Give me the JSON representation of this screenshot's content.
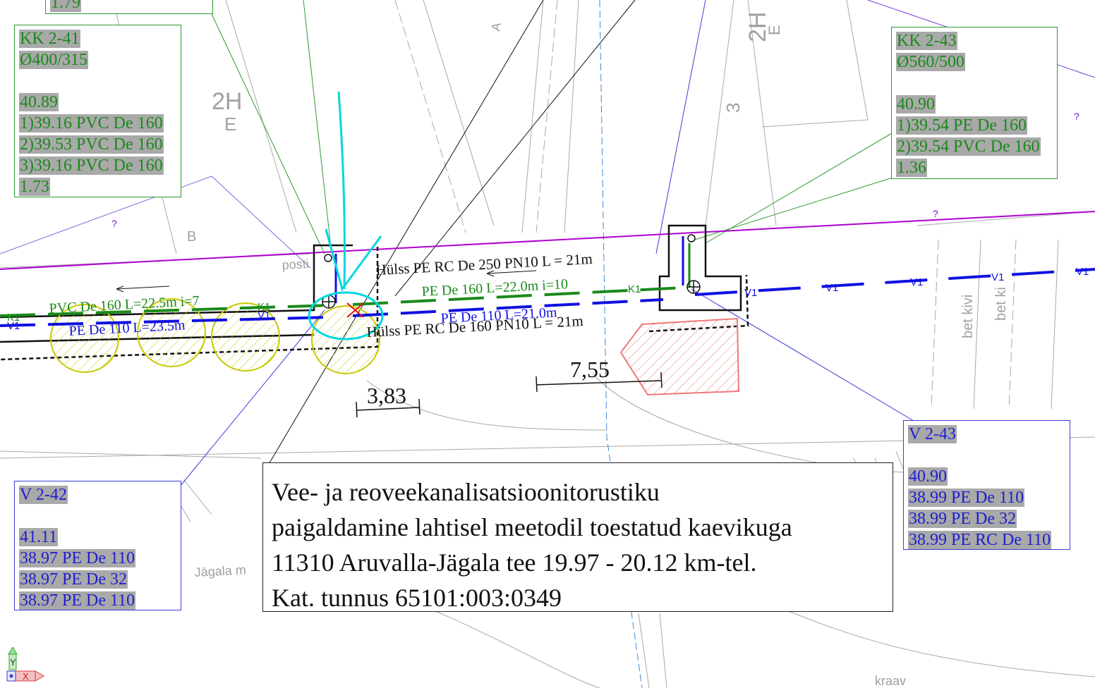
{
  "boxes": {
    "kk241": {
      "lines": [
        "KK 2-41",
        "Ø400/315",
        "",
        "40.89",
        "1)39.16 PVC De 160",
        "2)39.53 PVC De 160",
        "3)39.16 PVC De 160",
        "1.73"
      ]
    },
    "kk243": {
      "lines": [
        "KK 2-43",
        "Ø560/500",
        "",
        "40.90",
        "1)39.54 PE De 160",
        "2)39.54 PVC De 160",
        "1.36"
      ]
    },
    "v242": {
      "lines": [
        "V 2-42",
        "",
        "41.11",
        "38.97 PE De 110",
        "38.97 PE De 32",
        "38.97 PE De 110"
      ]
    },
    "v243": {
      "lines": [
        "V 2-43",
        "",
        "40.90",
        "38.99 PE De 110",
        "38.99 PE De 32",
        "38.99 PE RC De 110"
      ]
    },
    "top_partial": {
      "value": "1.79"
    }
  },
  "title_block": {
    "lines": [
      "Vee- ja reoveekanalisatsioonitorustiku",
      "paigaldamine lahtisel meetodil toestatud kaevikuga",
      "11310 Aruvalla-Jägala tee 19.97 - 20.12 km-tel.",
      "Kat. tunnus 65101:003:0349"
    ]
  },
  "pipe_labels": {
    "hulss_250": "Hülss PE RC De 250 PN10 L = 21m",
    "hulss_160": "Hülss PE RC De 160 PN10 L = 21m",
    "pe160": "PE De 160 L=22.0m i=10",
    "pe110_right": "PE De 110 L=21.0m",
    "pvc160": "PVC De 160 L=22.5m i=7",
    "pe110_left": "PE De 110 L=23.5m",
    "k1": "K1",
    "v1": "V1"
  },
  "dimensions": {
    "d1": "3,83",
    "d2": "7,55"
  },
  "map_text": {
    "posti": "posti",
    "b": "B",
    "a": "A",
    "h2_left": "2H",
    "e_left": "E",
    "h2_right": "2H",
    "e_right": "E",
    "three": "3",
    "bet_kivi": "bet kivi",
    "bet_ki": "bet ki",
    "jagala": "Jägala m",
    "kraav": "kraav",
    "q": "?"
  },
  "ucs": {
    "y": "Y",
    "x": "X"
  },
  "colors": {
    "water": "#1010e0",
    "sewer": "#1a8a1a",
    "gas": "#b000d0",
    "markup": "#00d8e0",
    "hatch_yellow": "#c8c800",
    "hatch_red": "#f07878",
    "base": "#a0a0a0"
  }
}
